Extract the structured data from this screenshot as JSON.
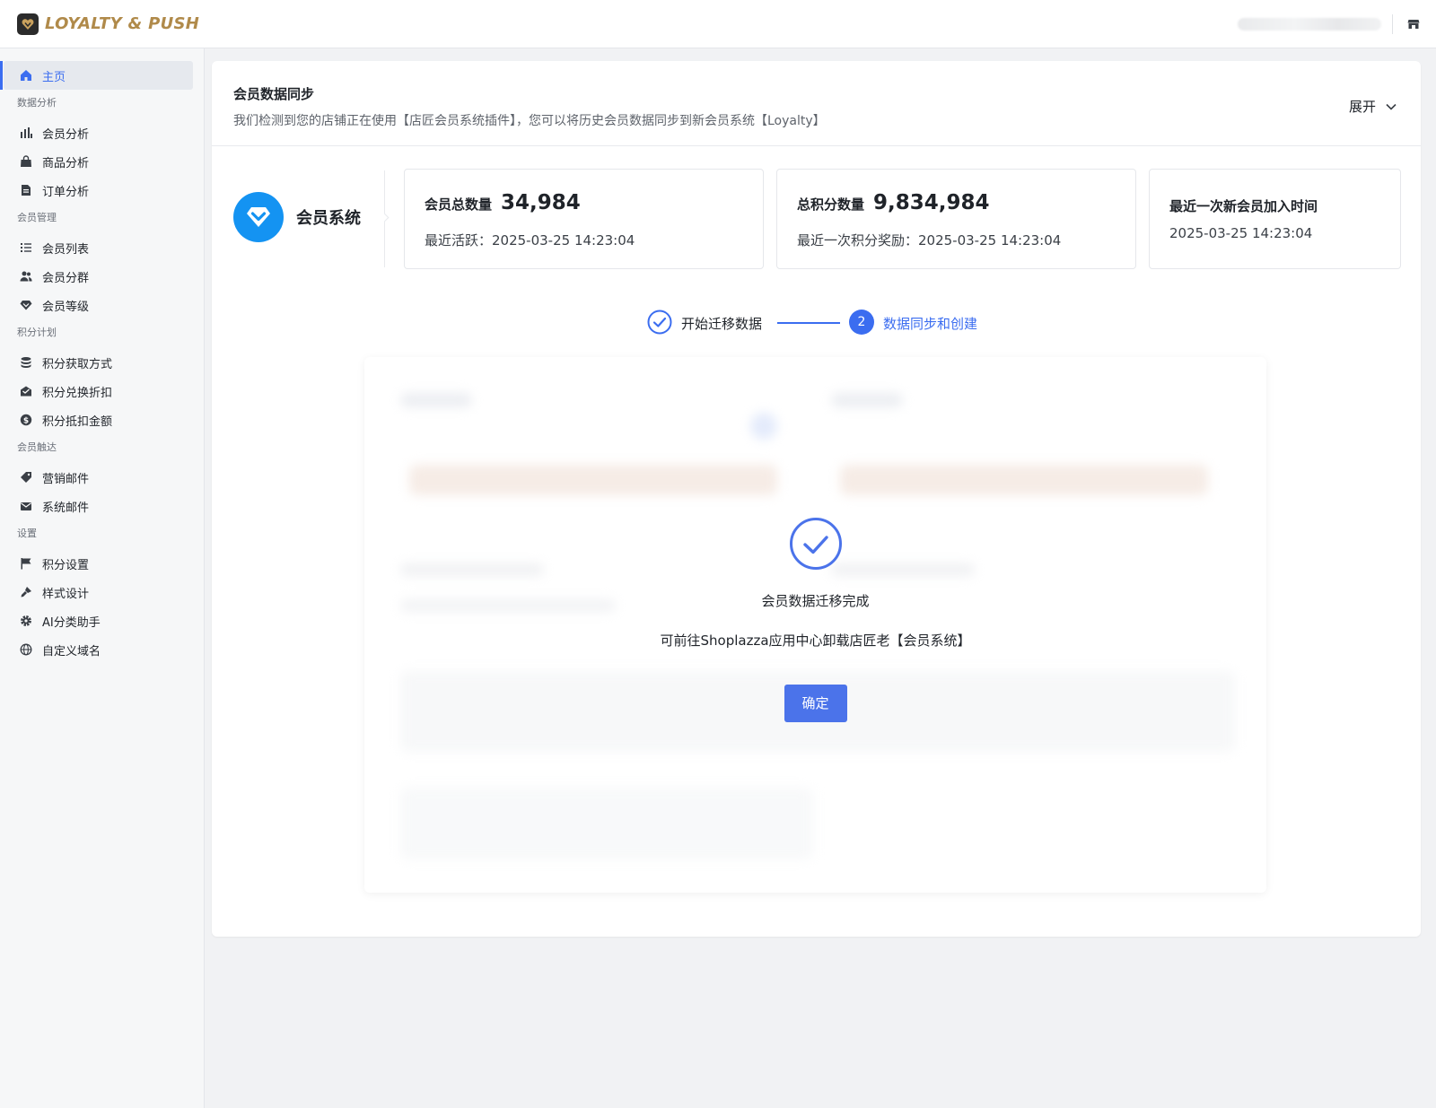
{
  "app": {
    "logo_text": "LOYALTY & PUSH",
    "brand_color": "#b08a4a",
    "accent_color": "#3b6df0"
  },
  "sidebar": {
    "home": {
      "label": "主页",
      "icon": "home-icon"
    },
    "sections": [
      {
        "title": "数据分析",
        "items": [
          {
            "label": "会员分析",
            "icon": "bar-chart-icon"
          },
          {
            "label": "商品分析",
            "icon": "shopping-bag-icon"
          },
          {
            "label": "订单分析",
            "icon": "document-icon"
          }
        ]
      },
      {
        "title": "会员管理",
        "items": [
          {
            "label": "会员列表",
            "icon": "list-icon"
          },
          {
            "label": "会员分群",
            "icon": "users-icon"
          },
          {
            "label": "会员等级",
            "icon": "diamond-icon"
          }
        ]
      },
      {
        "title": "积分计划",
        "items": [
          {
            "label": "积分获取方式",
            "icon": "database-icon"
          },
          {
            "label": "积分兑换折扣",
            "icon": "mail-open-icon"
          },
          {
            "label": "积分抵扣金额",
            "icon": "dollar-icon"
          }
        ]
      },
      {
        "title": "会员触达",
        "items": [
          {
            "label": "营销邮件",
            "icon": "tag-icon"
          },
          {
            "label": "系统邮件",
            "icon": "mail-icon"
          }
        ]
      },
      {
        "title": "设置",
        "items": [
          {
            "label": "积分设置",
            "icon": "flag-icon"
          },
          {
            "label": "样式设计",
            "icon": "brush-icon"
          },
          {
            "label": "AI分类助手",
            "icon": "gear-icon"
          },
          {
            "label": "自定义域名",
            "icon": "globe-icon"
          }
        ]
      }
    ]
  },
  "card": {
    "title": "会员数据同步",
    "description": "我们检测到您的店铺正在使用【店匠会员系统插件】，您可以将历史会员数据同步到新会员系统【Loyalty】",
    "expand_label": "展开"
  },
  "member_system": {
    "name": "会员系统",
    "stats": [
      {
        "label": "会员总数量",
        "value": "34,984",
        "sub": "最近活跃：2025-03-25 14:23:04"
      },
      {
        "label": "总积分数量",
        "value": "9,834,984",
        "sub": "最近一次积分奖励：2025-03-25 14:23:04"
      },
      {
        "label": "最近一次新会员加入时间",
        "value": "",
        "sub": "2025-03-25 14:23:04"
      }
    ]
  },
  "steps": [
    {
      "label": "开始迁移数据",
      "status": "done"
    },
    {
      "number": "2",
      "label": "数据同步和创建",
      "status": "active"
    }
  ],
  "modal": {
    "title": "会员数据迁移完成",
    "message": "可前往Shoplazza应用中心卸载店匠老【会员系统】",
    "confirm_label": "确定"
  }
}
